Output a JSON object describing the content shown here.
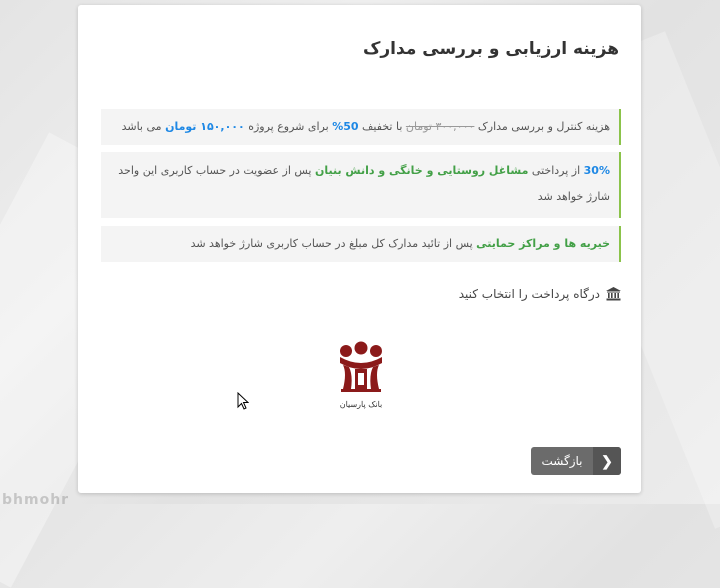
{
  "watermark": "bhmohr",
  "card": {
    "title": "هزینه ارزیابی و بررسی مدارک"
  },
  "notes": [
    {
      "text_1": "هزینه کنترل و بررسی مدارک",
      "old_price": "۳۰۰,۰۰۰ تومان",
      "text_2": "با تخفیف",
      "discount": "50%",
      "text_3": "برای شروع پروژه",
      "new_price": "۱۵۰,۰۰۰ تومان",
      "text_4": "می باشد"
    },
    {
      "percent": "30%",
      "text_1": "از پرداختی",
      "highlight": "مشاغل روستایی و خانگی و دانش بنیان",
      "text_2": "پس از عضویت در حساب کاربری این واحد شارژ خواهد شد"
    },
    {
      "highlight": "خیریه ها و مراکز حمایتی",
      "text_1": "پس از تائید مدارک کل مبلغ در حساب کاربری شارژ خواهد شد"
    }
  ],
  "gateway": {
    "label": "درگاه پرداخت را انتخاب کنید",
    "icon": "bank-icon"
  },
  "bank": {
    "name": "بانک پارسیان",
    "logo_color": "#8b1a1a"
  },
  "back_button": {
    "label": "بازگشت",
    "icon": "chevron-right-icon"
  },
  "colors": {
    "accent_green": "#8bc34a",
    "highlight_blue": "#1e88e5",
    "highlight_green": "#43a047",
    "button_gray": "#6b6b6b"
  }
}
